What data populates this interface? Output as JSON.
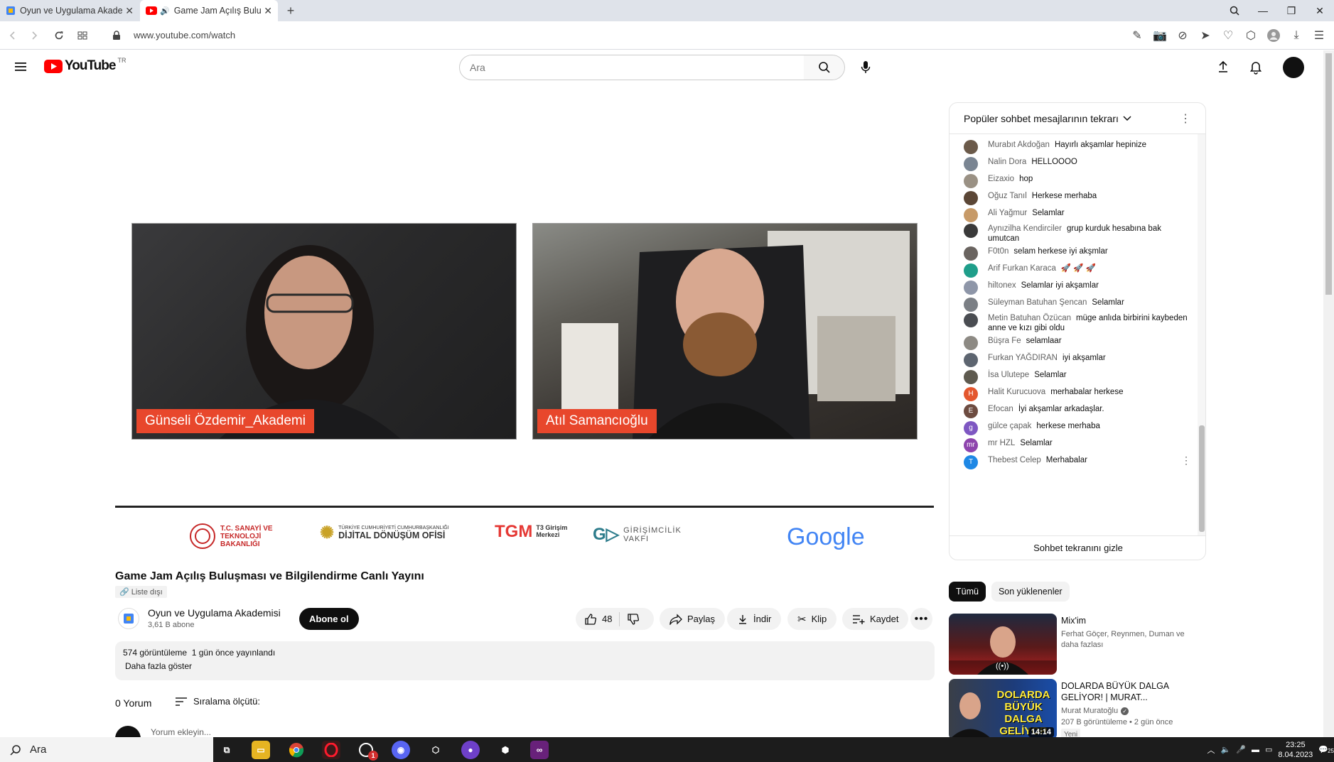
{
  "browser": {
    "tabs": [
      {
        "title": "Oyun ve Uygulama Akademi",
        "active": false,
        "icon": "google-icon"
      },
      {
        "title": "Game Jam Açılış Buluşm",
        "active": true,
        "icon": "youtube-icon"
      }
    ],
    "url": "www.youtube.com/watch"
  },
  "header": {
    "logo_text": "YouTube",
    "region": "TR",
    "search_placeholder": "Ara"
  },
  "video": {
    "participants": [
      "Günseli Özdemir_Akademi",
      "Atıl Samancıoğlu"
    ],
    "sponsors": [
      "T.C. SANAYİ VE TEKNOLOJİ BAKANLIĞI",
      "TÜRKİYE CUMHURİYETİ CUMHURBAŞKANLIĞI",
      "DİJİTAL DÖNÜŞÜM OFİSİ",
      "T3 Girişim Merkezi",
      "GİRİŞİMCİLİK VAKFI",
      "Google"
    ],
    "title": "Game Jam Açılış Buluşması ve Bilgilendirme Canlı Yayını",
    "visibility": "Liste dışı",
    "channel": {
      "name": "Oyun ve Uygulama Akademisi",
      "subscribers": "3,61 B abone"
    },
    "subscribe_label": "Abone ol",
    "likes": "48",
    "share_label": "Paylaş",
    "download_label": "İndir",
    "clip_label": "Klip",
    "save_label": "Kaydet",
    "views": "574 görüntüleme",
    "published": "1 gün önce yayınlandı",
    "show_more": "Daha fazla göster",
    "comments_count": "0 Yorum",
    "sort_label": "Sıralama ölçütü:",
    "comment_placeholder": "Yorum ekleyin..."
  },
  "chat": {
    "title": "Popüler sohbet mesajlarının tekrarı",
    "messages": [
      {
        "author": "Murabıt Akdoğan",
        "text": "Hayırlı akşamlar hepinize",
        "avatar_color": "#6b5a4a",
        "initial": ""
      },
      {
        "author": "Nalin Dora",
        "text": "HELLOOOO",
        "avatar_color": "#7a8592",
        "initial": ""
      },
      {
        "author": "Eizaxio",
        "text": "hop",
        "avatar_color": "#9a9184",
        "initial": ""
      },
      {
        "author": "Oğuz Tanıl",
        "text": "Herkese merhaba",
        "avatar_color": "#5b4636",
        "initial": ""
      },
      {
        "author": "Ali Yağmur",
        "text": "Selamlar",
        "avatar_color": "#c79a68",
        "initial": ""
      },
      {
        "author": "Aynızilha Kendirciler",
        "text": "grup kurduk hesabına bak umutcan",
        "avatar_color": "#3a3a3a",
        "initial": ""
      },
      {
        "author": "F0t0n",
        "text": "selam herkese iyi akşmlar",
        "avatar_color": "#6a6460",
        "initial": ""
      },
      {
        "author": "Arif Furkan Karaca",
        "text": "🚀 🚀 🚀",
        "avatar_color": "#1f9e8a",
        "initial": ""
      },
      {
        "author": "hiltonex",
        "text": "Selamlar iyi akşamlar",
        "avatar_color": "#8e96a8",
        "initial": ""
      },
      {
        "author": "Süleyman Batuhan Şencan",
        "text": "Selamlar",
        "avatar_color": "#7b7f85",
        "initial": ""
      },
      {
        "author": "Metin Batuhan Özücan",
        "text": "müge anlıda birbirini kaybeden anne ve kızı gibi oldu",
        "avatar_color": "#4a4d52",
        "initial": ""
      },
      {
        "author": "Büşra Fe",
        "text": "selamlaar",
        "avatar_color": "#8d8a84",
        "initial": ""
      },
      {
        "author": "Furkan YAĞDIRAN",
        "text": "iyi akşamlar",
        "avatar_color": "#5d6570",
        "initial": ""
      },
      {
        "author": "İsa Ulutepe",
        "text": "Selamlar",
        "avatar_color": "#5e5a4f",
        "initial": ""
      },
      {
        "author": "Halit Kurucuova",
        "text": "merhabalar herkese",
        "avatar_color": "#e4572e",
        "initial": "H"
      },
      {
        "author": "Efocan",
        "text": "İyi akşamlar arkadaşlar.",
        "avatar_color": "#6d4c41",
        "initial": "E"
      },
      {
        "author": "gülce çapak",
        "text": "herkese merhaba",
        "avatar_color": "#7e57c2",
        "initial": "g"
      },
      {
        "author": "mr HZL",
        "text": "Selamlar",
        "avatar_color": "#8e44ad",
        "initial": "mr"
      },
      {
        "author": "Thebest Celep",
        "text": "Merhabalar",
        "avatar_color": "#1e88e5",
        "initial": "T"
      }
    ],
    "hide_label": "Sohbet tekranını gizle"
  },
  "recommendations": {
    "chips": [
      "Tümü",
      "Son yüklenenler"
    ],
    "items": [
      {
        "title": "Mix'im",
        "meta1": "Ferhat Göçer, Reynmen, Duman ve daha fazlası",
        "meta2": "",
        "duration": "",
        "badge": ""
      },
      {
        "title": "DOLARDA BÜYÜK DALGA GELİYOR! | MURAT...",
        "meta1": "Murat Muratoğlu",
        "meta2": "207 B görüntüleme • 2 gün önce",
        "duration": "14:14",
        "badge": "Yeni",
        "thumb_text": "DOLARDA BÜYÜK DALGA GELİYOR"
      }
    ]
  },
  "taskbar": {
    "search_label": "Ara",
    "time": "23:25",
    "date": "8.04.2023",
    "notifications": "25",
    "badge": "1"
  }
}
